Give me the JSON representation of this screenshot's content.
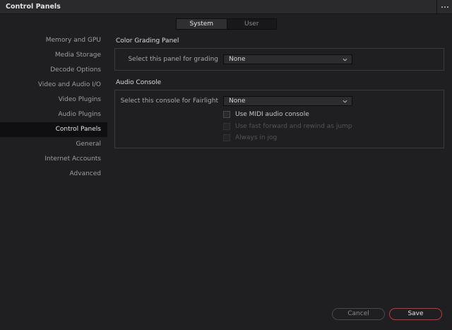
{
  "window": {
    "title": "Control Panels",
    "menu_icon": "more-dots-icon"
  },
  "tabs": [
    {
      "label": "System",
      "active": true
    },
    {
      "label": "User",
      "active": false
    }
  ],
  "sidebar": {
    "items": [
      {
        "label": "Memory and GPU"
      },
      {
        "label": "Media Storage"
      },
      {
        "label": "Decode Options"
      },
      {
        "label": "Video and Audio I/O"
      },
      {
        "label": "Video Plugins"
      },
      {
        "label": "Audio Plugins"
      },
      {
        "label": "Control Panels",
        "active": true
      },
      {
        "label": "General"
      },
      {
        "label": "Internet Accounts"
      },
      {
        "label": "Advanced"
      }
    ]
  },
  "color_grading": {
    "title": "Color Grading Panel",
    "select_label": "Select this panel for grading",
    "select_value": "None"
  },
  "audio_console": {
    "title": "Audio Console",
    "select_label": "Select this console for Fairlight",
    "select_value": "None",
    "options": [
      {
        "label": "Use MIDI audio console",
        "checked": false,
        "enabled": true
      },
      {
        "label": "Use fast forward and rewind as jump",
        "checked": false,
        "enabled": false
      },
      {
        "label": "Always in jog",
        "checked": false,
        "enabled": false
      }
    ]
  },
  "footer": {
    "cancel_label": "Cancel",
    "save_label": "Save"
  },
  "colors": {
    "accent": "#c9333a",
    "background": "#1f1f22",
    "titlebar": "#2a2a2d"
  }
}
